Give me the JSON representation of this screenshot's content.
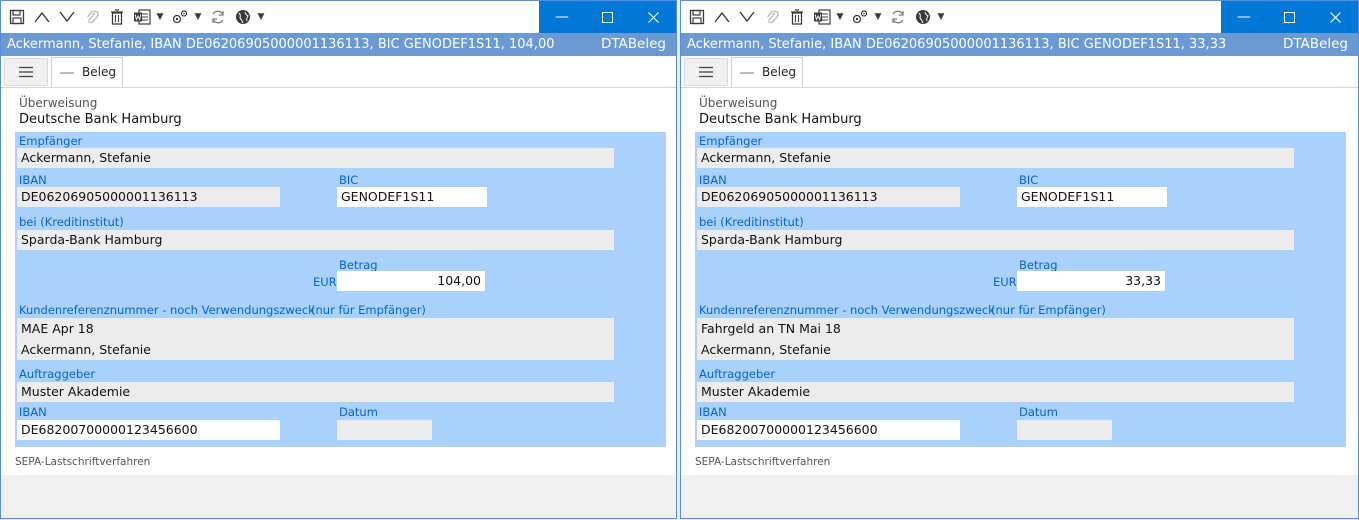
{
  "windows": [
    {
      "id": "left",
      "title": "Ackermann, Stefanie, IBAN DE06206905000001136113, BIC GENODEF1S11, 104,00",
      "type_label": "DTABeleg",
      "tab_label": "Beleg",
      "form": {
        "section_label": "Überweisung",
        "bank_name": "Deutsche Bank Hamburg",
        "recipient_label": "Empfänger",
        "recipient": "Ackermann, Stefanie",
        "iban_label": "IBAN",
        "iban": "DE06206905000001136113",
        "bic_label": "BIC",
        "bic": "GENODEF1S11",
        "institute_label": "bei (Kreditinstitut)",
        "institute": "Sparda-Bank Hamburg",
        "amount_label": "Betrag",
        "currency": "EUR",
        "amount": "104,00",
        "reference_label": "Kundenreferenznummer - noch Verwendungszweck",
        "reference_note": "(nur für Empfänger)",
        "reference_line1": "MAE Apr 18",
        "reference_line2": "Ackermann, Stefanie",
        "payer_label": "Auftraggeber",
        "payer": "Muster Akademie",
        "payer_iban_label": "IBAN",
        "payer_iban": "DE68200700000123456600",
        "date_label": "Datum",
        "date": "",
        "footer": "SEPA-Lastschriftverfahren"
      }
    },
    {
      "id": "right",
      "title": "Ackermann, Stefanie, IBAN DE06206905000001136113, BIC GENODEF1S11, 33,33",
      "type_label": "DTABeleg",
      "tab_label": "Beleg",
      "form": {
        "section_label": "Überweisung",
        "bank_name": "Deutsche Bank Hamburg",
        "recipient_label": "Empfänger",
        "recipient": "Ackermann, Stefanie",
        "iban_label": "IBAN",
        "iban": "DE06206905000001136113",
        "bic_label": "BIC",
        "bic": "GENODEF1S11",
        "institute_label": "bei (Kreditinstitut)",
        "institute": "Sparda-Bank Hamburg",
        "amount_label": "Betrag",
        "currency": "EUR",
        "amount": "33,33",
        "reference_label": "Kundenreferenznummer - noch Verwendungszweck",
        "reference_note": "(nur für Empfänger)",
        "reference_line1": "Fahrgeld an TN Mai 18",
        "reference_line2": "Ackermann, Stefanie",
        "payer_label": "Auftraggeber",
        "payer": "Muster Akademie",
        "payer_iban_label": "IBAN",
        "payer_iban": "DE68200700000123456600",
        "date_label": "Datum",
        "date": "",
        "footer": "SEPA-Lastschriftverfahren"
      }
    }
  ],
  "icons": {
    "toolbar": [
      "save-icon",
      "arrow-up-icon",
      "arrow-down-icon",
      "attach-icon",
      "trash-icon",
      "word-icon",
      "gears-icon",
      "refresh-icon",
      "globe-icon"
    ],
    "window_controls": [
      "minimize-icon",
      "maximize-icon",
      "close-icon"
    ],
    "menu": "hamburger-icon"
  },
  "colors": {
    "accent": "#0078d7",
    "titlebar": "#6b9ad3",
    "form_panel": "#a9d1fb",
    "label_blue": "#0a64c8"
  }
}
